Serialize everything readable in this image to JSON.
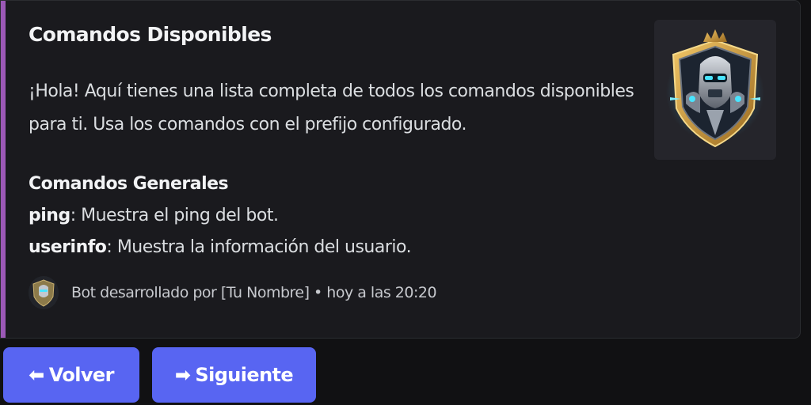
{
  "embed": {
    "accent_color": "#9b59b6",
    "title": "Comandos Disponibles",
    "description": "¡Hola! Aquí tienes una lista completa de todos los comandos disponibles para ti. Usa los comandos con el prefijo configurado.",
    "fields": [
      {
        "name": "Comandos Generales",
        "commands": [
          {
            "command": "ping",
            "text": ": Muestra el ping del bot."
          },
          {
            "command": "userinfo",
            "text": ": Muestra la información del usuario."
          }
        ]
      }
    ],
    "thumbnail_icon": "robot-shield-logo",
    "footer": {
      "icon": "robot-avatar-icon",
      "text": "Bot desarrollado por [Tu Nombre] • hoy a las 20:20"
    }
  },
  "buttons": {
    "back": {
      "arrow": "⬅",
      "label": "Volver"
    },
    "next": {
      "arrow": "➡",
      "label": "Siguiente"
    },
    "color": "#5865f2"
  }
}
